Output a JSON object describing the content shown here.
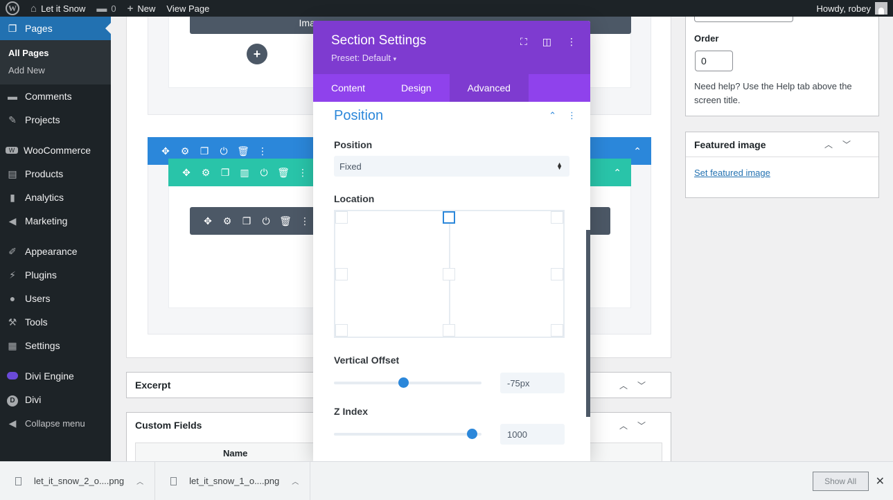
{
  "admin_bar": {
    "site_name": "Let it Snow",
    "comments_count": "0",
    "new_label": "New",
    "view_page_label": "View Page",
    "greeting": "Howdy, robey"
  },
  "sidebar": {
    "current": "Pages",
    "submenu": [
      "All Pages",
      "Add New"
    ],
    "items": [
      "Comments",
      "Projects",
      "WooCommerce",
      "Products",
      "Analytics",
      "Marketing",
      "Appearance",
      "Plugins",
      "Users",
      "Tools",
      "Settings",
      "Divi Engine",
      "Divi",
      "Collapse menu"
    ]
  },
  "builder": {
    "module_label": "Image"
  },
  "postboxes": {
    "excerpt": "Excerpt",
    "custom_fields": "Custom Fields",
    "name_col": "Name"
  },
  "right_sidebar": {
    "order_label": "Order",
    "order_value": "0",
    "help_text": "Need help? Use the Help tab above the screen title.",
    "featured_title": "Featured image",
    "featured_link": "Set featured image"
  },
  "modal": {
    "title": "Section Settings",
    "preset": "Preset: Default",
    "tabs": [
      "Content",
      "Design",
      "Advanced"
    ],
    "active_tab": "Advanced",
    "group_title": "Position",
    "position_label": "Position",
    "position_value": "Fixed",
    "location_label": "Location",
    "vertical_offset_label": "Vertical Offset",
    "vertical_offset_value": "-75px",
    "vertical_offset_level": 0.47,
    "z_index_label": "Z Index",
    "z_index_value": "1000",
    "z_index_level": 0.97
  },
  "downloads": {
    "items": [
      "let_it_snow_2_o....png",
      "let_it_snow_1_o....png"
    ],
    "show_all": "Show All"
  },
  "colors": {
    "admin_dark": "#1d2327",
    "wp_blue": "#2271b1",
    "divi_purple": "#7e3bd0",
    "divi_purple_tabs": "#8f42ec",
    "section_blue": "#2b87da",
    "row_teal": "#29c4a9",
    "module_gray": "#4c5866"
  }
}
